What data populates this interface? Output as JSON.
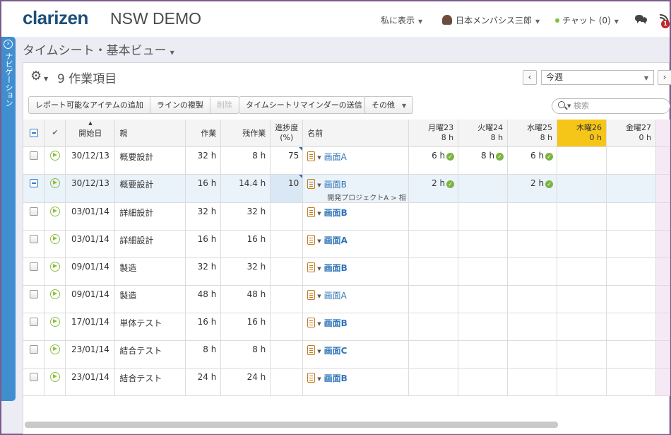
{
  "header": {
    "logo": "clarizen",
    "instance": "NSW DEMO",
    "show_to_me": "私に表示",
    "user": "日本メンバシス三郎",
    "chat": "チャット (0)",
    "notification_count": "1"
  },
  "nav": {
    "label": "ナビゲーション"
  },
  "view": {
    "title": "タイムシート・基本ビュー"
  },
  "items": {
    "title": "9 作業項目"
  },
  "period": {
    "selected": "今週",
    "prev": "‹",
    "next": "›"
  },
  "toolbar": {
    "add_reportable": "レポート可能なアイテムの追加",
    "duplicate_line": "ラインの複製",
    "delete": "削除",
    "send_reminder": "タイムシートリマインダーの送信",
    "more": "その他"
  },
  "search": {
    "placeholder": "検索"
  },
  "columns": {
    "start_date": "開始日",
    "parent": "親",
    "work": "作業",
    "remaining": "残作業",
    "progress": "進捗度(%)",
    "name": "名前",
    "days": [
      {
        "label": "月曜23",
        "total": "8 h",
        "today": false
      },
      {
        "label": "火曜24",
        "total": "8 h",
        "today": false
      },
      {
        "label": "水曜25",
        "total": "8 h",
        "today": false
      },
      {
        "label": "木曜26",
        "total": "0 h",
        "today": true
      },
      {
        "label": "金曜27",
        "total": "0 h",
        "today": false
      }
    ]
  },
  "rows": [
    {
      "start": "30/12/13",
      "parent": "概要設計",
      "work": "32 h",
      "remaining": "8 h",
      "progress": "75",
      "name": "画面A",
      "bold": false,
      "sub": "",
      "selected": false,
      "mon": "6 h",
      "tue": "8 h",
      "wed": "6 h"
    },
    {
      "start": "30/12/13",
      "parent": "概要設計",
      "work": "16 h",
      "remaining": "14.4 h",
      "progress": "10",
      "name": "画面B",
      "bold": false,
      "sub": "開発プロジェクトA > 相",
      "selected": true,
      "mon": "2 h",
      "tue": "",
      "wed": "2 h"
    },
    {
      "start": "03/01/14",
      "parent": "詳細設計",
      "work": "32 h",
      "remaining": "32 h",
      "progress": "",
      "name": "画面B",
      "bold": true,
      "sub": "",
      "selected": false,
      "mon": "",
      "tue": "",
      "wed": ""
    },
    {
      "start": "03/01/14",
      "parent": "詳細設計",
      "work": "16 h",
      "remaining": "16 h",
      "progress": "",
      "name": "画面A",
      "bold": true,
      "sub": "",
      "selected": false,
      "mon": "",
      "tue": "",
      "wed": ""
    },
    {
      "start": "09/01/14",
      "parent": "製造",
      "work": "32 h",
      "remaining": "32 h",
      "progress": "",
      "name": "画面B",
      "bold": true,
      "sub": "",
      "selected": false,
      "mon": "",
      "tue": "",
      "wed": ""
    },
    {
      "start": "09/01/14",
      "parent": "製造",
      "work": "48 h",
      "remaining": "48 h",
      "progress": "",
      "name": "画面A",
      "bold": false,
      "sub": "",
      "selected": false,
      "mon": "",
      "tue": "",
      "wed": ""
    },
    {
      "start": "17/01/14",
      "parent": "単体テスト",
      "work": "16 h",
      "remaining": "16 h",
      "progress": "",
      "name": "画面B",
      "bold": true,
      "sub": "",
      "selected": false,
      "mon": "",
      "tue": "",
      "wed": ""
    },
    {
      "start": "23/01/14",
      "parent": "結合テスト",
      "work": "8 h",
      "remaining": "8 h",
      "progress": "",
      "name": "画面C",
      "bold": true,
      "sub": "",
      "selected": false,
      "mon": "",
      "tue": "",
      "wed": ""
    },
    {
      "start": "23/01/14",
      "parent": "結合テスト",
      "work": "24 h",
      "remaining": "24 h",
      "progress": "",
      "name": "画面B",
      "bold": true,
      "sub": "",
      "selected": false,
      "mon": "",
      "tue": "",
      "wed": ""
    }
  ]
}
